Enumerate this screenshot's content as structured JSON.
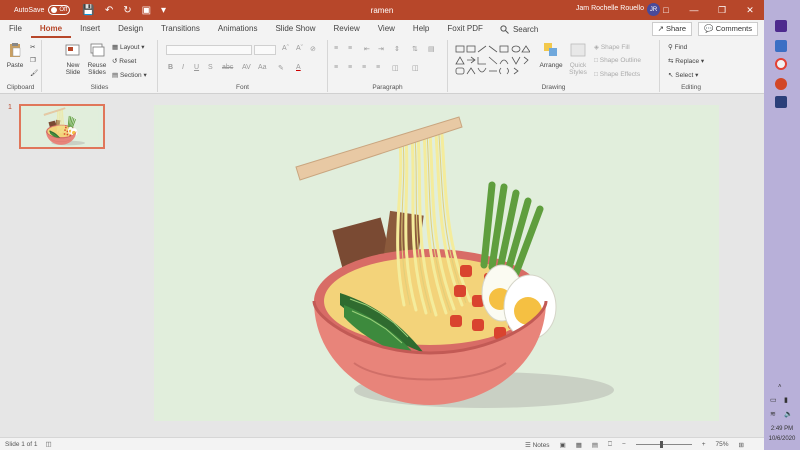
{
  "window": {
    "autosave_label": "AutoSave",
    "autosave_state": "Off",
    "doc_title": "ramen",
    "user_name": "Jam Rochelle Rouello",
    "user_initials": "JR"
  },
  "tabs": [
    "File",
    "Home",
    "Insert",
    "Design",
    "Transitions",
    "Animations",
    "Slide Show",
    "Review",
    "View",
    "Help",
    "Foxit PDF"
  ],
  "active_tab": "Home",
  "search_label": "Search",
  "share_label": "Share",
  "comments_label": "Comments",
  "ribbon": {
    "clipboard": {
      "label": "Clipboard",
      "paste": "Paste"
    },
    "slides": {
      "label": "Slides",
      "new_slide_line1": "New",
      "new_slide_line2": "Slide",
      "reuse_line1": "Reuse",
      "reuse_line2": "Slides",
      "layout": "Layout",
      "reset": "Reset",
      "section": "Section"
    },
    "font": {
      "label": "Font"
    },
    "paragraph": {
      "label": "Paragraph"
    },
    "drawing": {
      "label": "Drawing",
      "arrange": "Arrange",
      "quick_styles_line1": "Quick",
      "quick_styles_line2": "Styles",
      "shape_fill": "Shape Fill",
      "shape_outline": "Shape Outline",
      "shape_effects": "Shape Effects"
    },
    "editing": {
      "label": "Editing",
      "find": "Find",
      "replace": "Replace",
      "select": "Select"
    }
  },
  "thumbnail": {
    "number": "1"
  },
  "status": {
    "slide_info": "Slide 1 of 1",
    "notes_label": "Notes",
    "zoom": "75%"
  },
  "taskbar": {
    "time": "2:49 PM",
    "date": "10/6/2020"
  },
  "colors": {
    "accent": "#b7472a",
    "slide_bg": "#e1eedc",
    "bowl": "#e8847a",
    "noodle": "#f3e9a0"
  }
}
